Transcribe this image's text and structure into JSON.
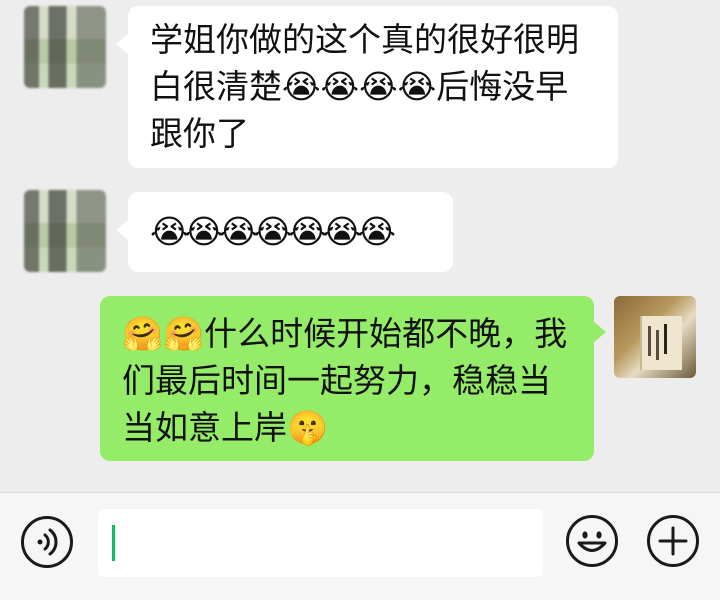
{
  "messages": [
    {
      "sender": "other",
      "text": "学姐你做的这个真的很好很明白很清楚😭😭😭😭后悔没早跟你了",
      "lines": [
        "学姐你做的这个真的很好很明",
        "白很清楚😭😭😭😭后悔没早",
        "跟你了"
      ]
    },
    {
      "sender": "other",
      "text": "😭😭😭😭😭😭😭",
      "lines": [
        "😭😭😭😭😭😭😭"
      ]
    },
    {
      "sender": "me",
      "text": "🤗🤗什么时候开始都不晚，我们最后时间一起努力，稳稳当当如意上岸🤫",
      "lines": [
        "🤗🤗什么时候开始都不晚，我",
        "们最后时间一起努力，稳稳当",
        "当如意上岸🤫"
      ]
    }
  ],
  "input_bar": {
    "voice_icon": "voice-icon",
    "emoji_icon": "emoji-icon",
    "add_icon": "add-icon",
    "input_value": ""
  },
  "colors": {
    "background": "#ededed",
    "incoming_bubble": "#ffffff",
    "outgoing_bubble": "#95ec69",
    "caret": "#07c160"
  }
}
